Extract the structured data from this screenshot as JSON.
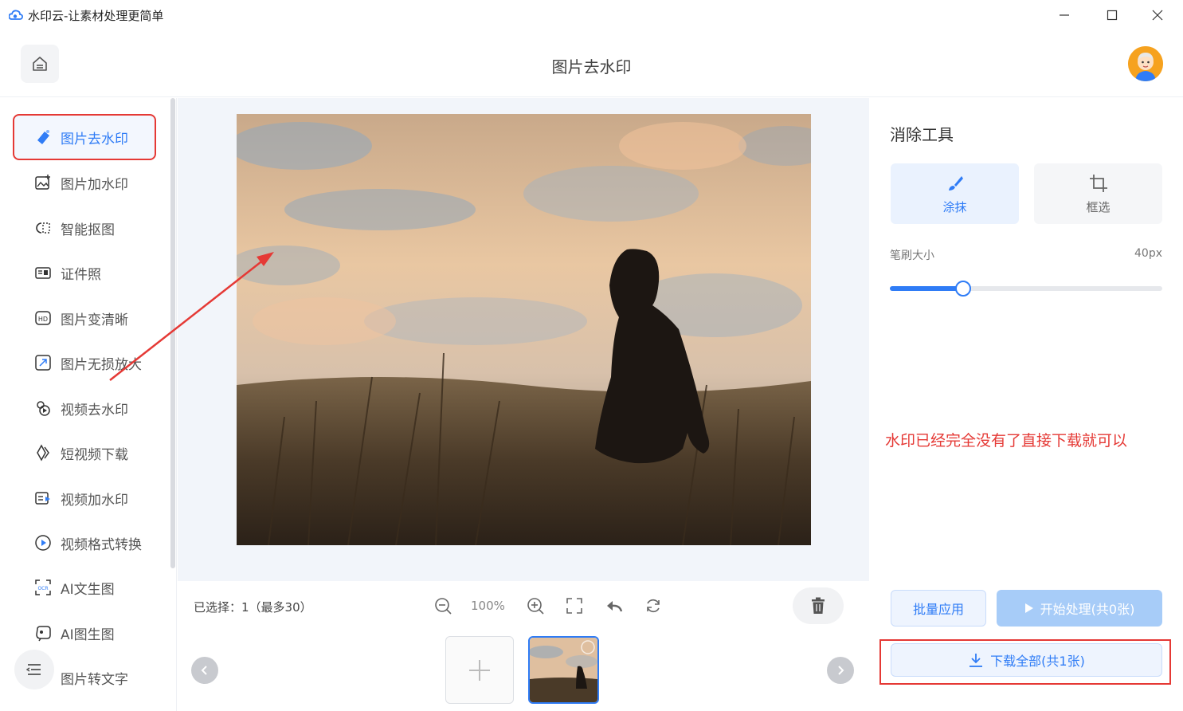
{
  "window": {
    "title": "水印云-让素材处理更简单"
  },
  "header": {
    "title": "图片去水印"
  },
  "colors": {
    "accent": "#2f7cf6",
    "annotation": "#e53935"
  },
  "sidebar": {
    "items": [
      {
        "label": "图片去水印",
        "icon": "eraser-icon"
      },
      {
        "label": "图片加水印",
        "icon": "image-add-icon"
      },
      {
        "label": "智能抠图",
        "icon": "cutout-icon"
      },
      {
        "label": "证件照",
        "icon": "id-card-icon"
      },
      {
        "label": "图片变清晰",
        "icon": "hd-icon"
      },
      {
        "label": "图片无损放大",
        "icon": "enlarge-icon"
      },
      {
        "label": "视频去水印",
        "icon": "video-eraser-icon"
      },
      {
        "label": "短视频下载",
        "icon": "video-download-icon"
      },
      {
        "label": "视频加水印",
        "icon": "video-add-icon"
      },
      {
        "label": "视频格式转换",
        "icon": "play-circle-icon"
      },
      {
        "label": "AI文生图",
        "icon": "ocr-icon"
      },
      {
        "label": "AI图生图",
        "icon": "ai-image-icon"
      },
      {
        "label": "图片转文字",
        "icon": "text-icon"
      }
    ]
  },
  "toolbar": {
    "selected": "已选择：1（最多30）",
    "zoom": "100%"
  },
  "right_panel": {
    "title": "消除工具",
    "tools": [
      {
        "label": "涂抹",
        "icon": "brush-icon"
      },
      {
        "label": "框选",
        "icon": "crop-icon"
      }
    ],
    "brush_label": "笔刷大小",
    "brush_value": "40px",
    "brush_level": 0.27,
    "note": "水印已经完全没有了直接下载就可以",
    "batch_label": "批量应用",
    "start_label": "开始处理(共0张)",
    "download_label": "下载全部(共1张)"
  }
}
